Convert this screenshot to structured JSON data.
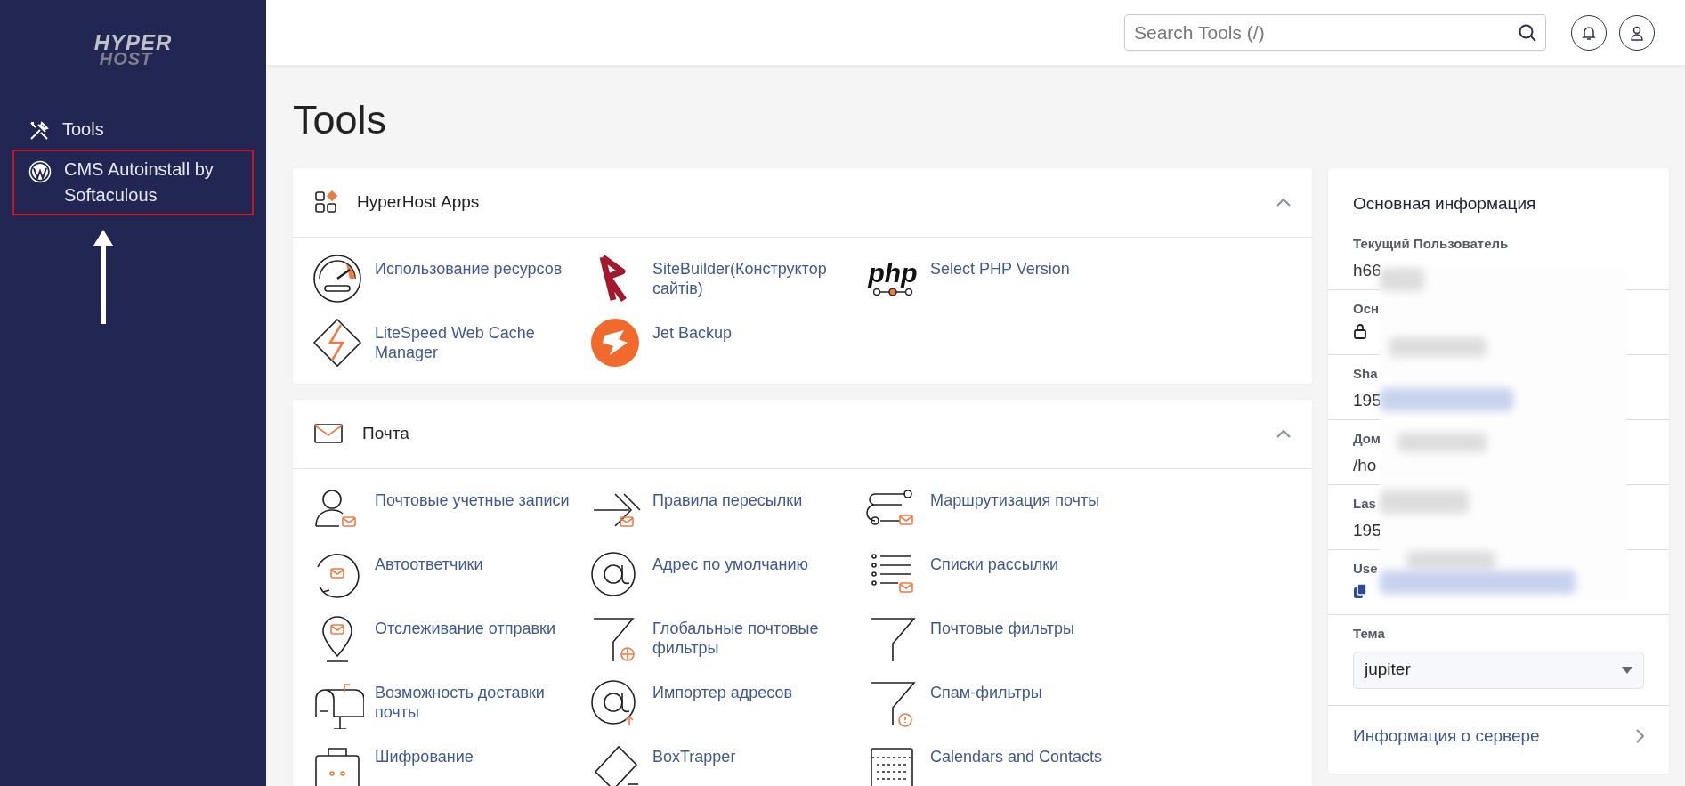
{
  "sidebar": {
    "logo": [
      "HYPER",
      "HOST"
    ],
    "items": [
      {
        "label": "Tools",
        "highlighted": false
      },
      {
        "label": "CMS Autoinstall by Softaculous",
        "highlighted": true
      }
    ]
  },
  "header": {
    "search": {
      "placeholder": "Search Tools (/)"
    }
  },
  "page_title": "Tools",
  "sections": [
    {
      "title": "HyperHost Apps",
      "expanded": true,
      "items": [
        {
          "label": "Использование ресурсов"
        },
        {
          "label": "SiteBuilder(Конструктор сайтів)"
        },
        {
          "label": "Select PHP Version",
          "logo_text": "php"
        },
        {
          "label": "LiteSpeed Web Cache Manager"
        },
        {
          "label": "Jet Backup"
        }
      ]
    },
    {
      "title": "Почта",
      "expanded": true,
      "items": [
        {
          "label": "Почтовые учетные записи"
        },
        {
          "label": "Правила пересылки"
        },
        {
          "label": "Маршрутизация почты"
        },
        {
          "label": "Автоответчики"
        },
        {
          "label": "Адрес по умолчанию"
        },
        {
          "label": "Списки рассылки"
        },
        {
          "label": "Отслеживание отправки"
        },
        {
          "label": "Глобальные почтовые фильтры"
        },
        {
          "label": "Почтовые фильтры"
        },
        {
          "label": "Возможность доставки почты"
        },
        {
          "label": "Импортер адресов"
        },
        {
          "label": "Спам-фильтры"
        },
        {
          "label": "Шифрование"
        },
        {
          "label": "BoxTrapper"
        },
        {
          "label": "Calendars and Contacts"
        }
      ]
    }
  ],
  "info": {
    "title": "Основная информация",
    "rows": [
      {
        "label": "Текущий Пользователь",
        "value": "h66"
      },
      {
        "label": "Осн",
        "kind": "lock-link"
      },
      {
        "label": "Sha",
        "value": "195"
      },
      {
        "label": "Дом",
        "value": "/ho"
      },
      {
        "label": "Las",
        "value": "195"
      },
      {
        "label": "Use",
        "kind": "copy-link"
      }
    ],
    "theme": {
      "label": "Тема",
      "value": "jupiter"
    },
    "server_link": "Информация о сервере"
  }
}
